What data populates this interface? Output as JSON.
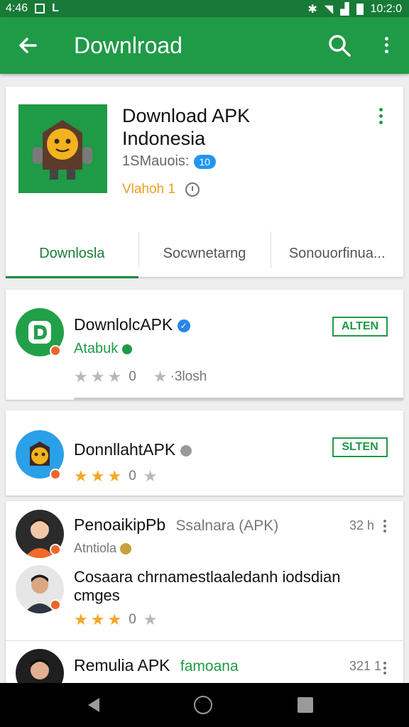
{
  "status_bar": {
    "time_left": "4:46",
    "time_right": "10:2:0"
  },
  "app_bar": {
    "title": "Downlroad"
  },
  "featured": {
    "app_name_line1": "Download APK",
    "app_name_line2": "Indonesia",
    "meta_label": "1SMauois:",
    "meta_badge": "10",
    "rating_text": "Vlahoh 1",
    "tabs": [
      {
        "label": "Downlosla"
      },
      {
        "label": "Socwnetarng"
      },
      {
        "label": "Sonouorfinua..."
      }
    ]
  },
  "list": {
    "items": [
      {
        "title": "DownlolcAPK",
        "subtitle": "Atabuk",
        "rating_num": "0",
        "installs": "·3losh",
        "button": "ALTEN"
      },
      {
        "title": "DonnllahtAPK",
        "rating_num": "0",
        "button": "SLTEN"
      },
      {
        "title": "PenoaikipPb",
        "title_suffix": "Ssalnara (APK)",
        "subtitle": "Atntiola",
        "time": "32 h"
      },
      {
        "body_line1": "Cosaara chrnamestlaaledanh iodsdian",
        "body_line2": "cmges",
        "rating_num": "0"
      },
      {
        "title": "Remulia APK",
        "title_suffix": "famoana",
        "time": "321 1"
      }
    ]
  },
  "colors": {
    "primary": "#1f9a47",
    "primary_dark": "#177a36",
    "star": "#f5a623"
  }
}
